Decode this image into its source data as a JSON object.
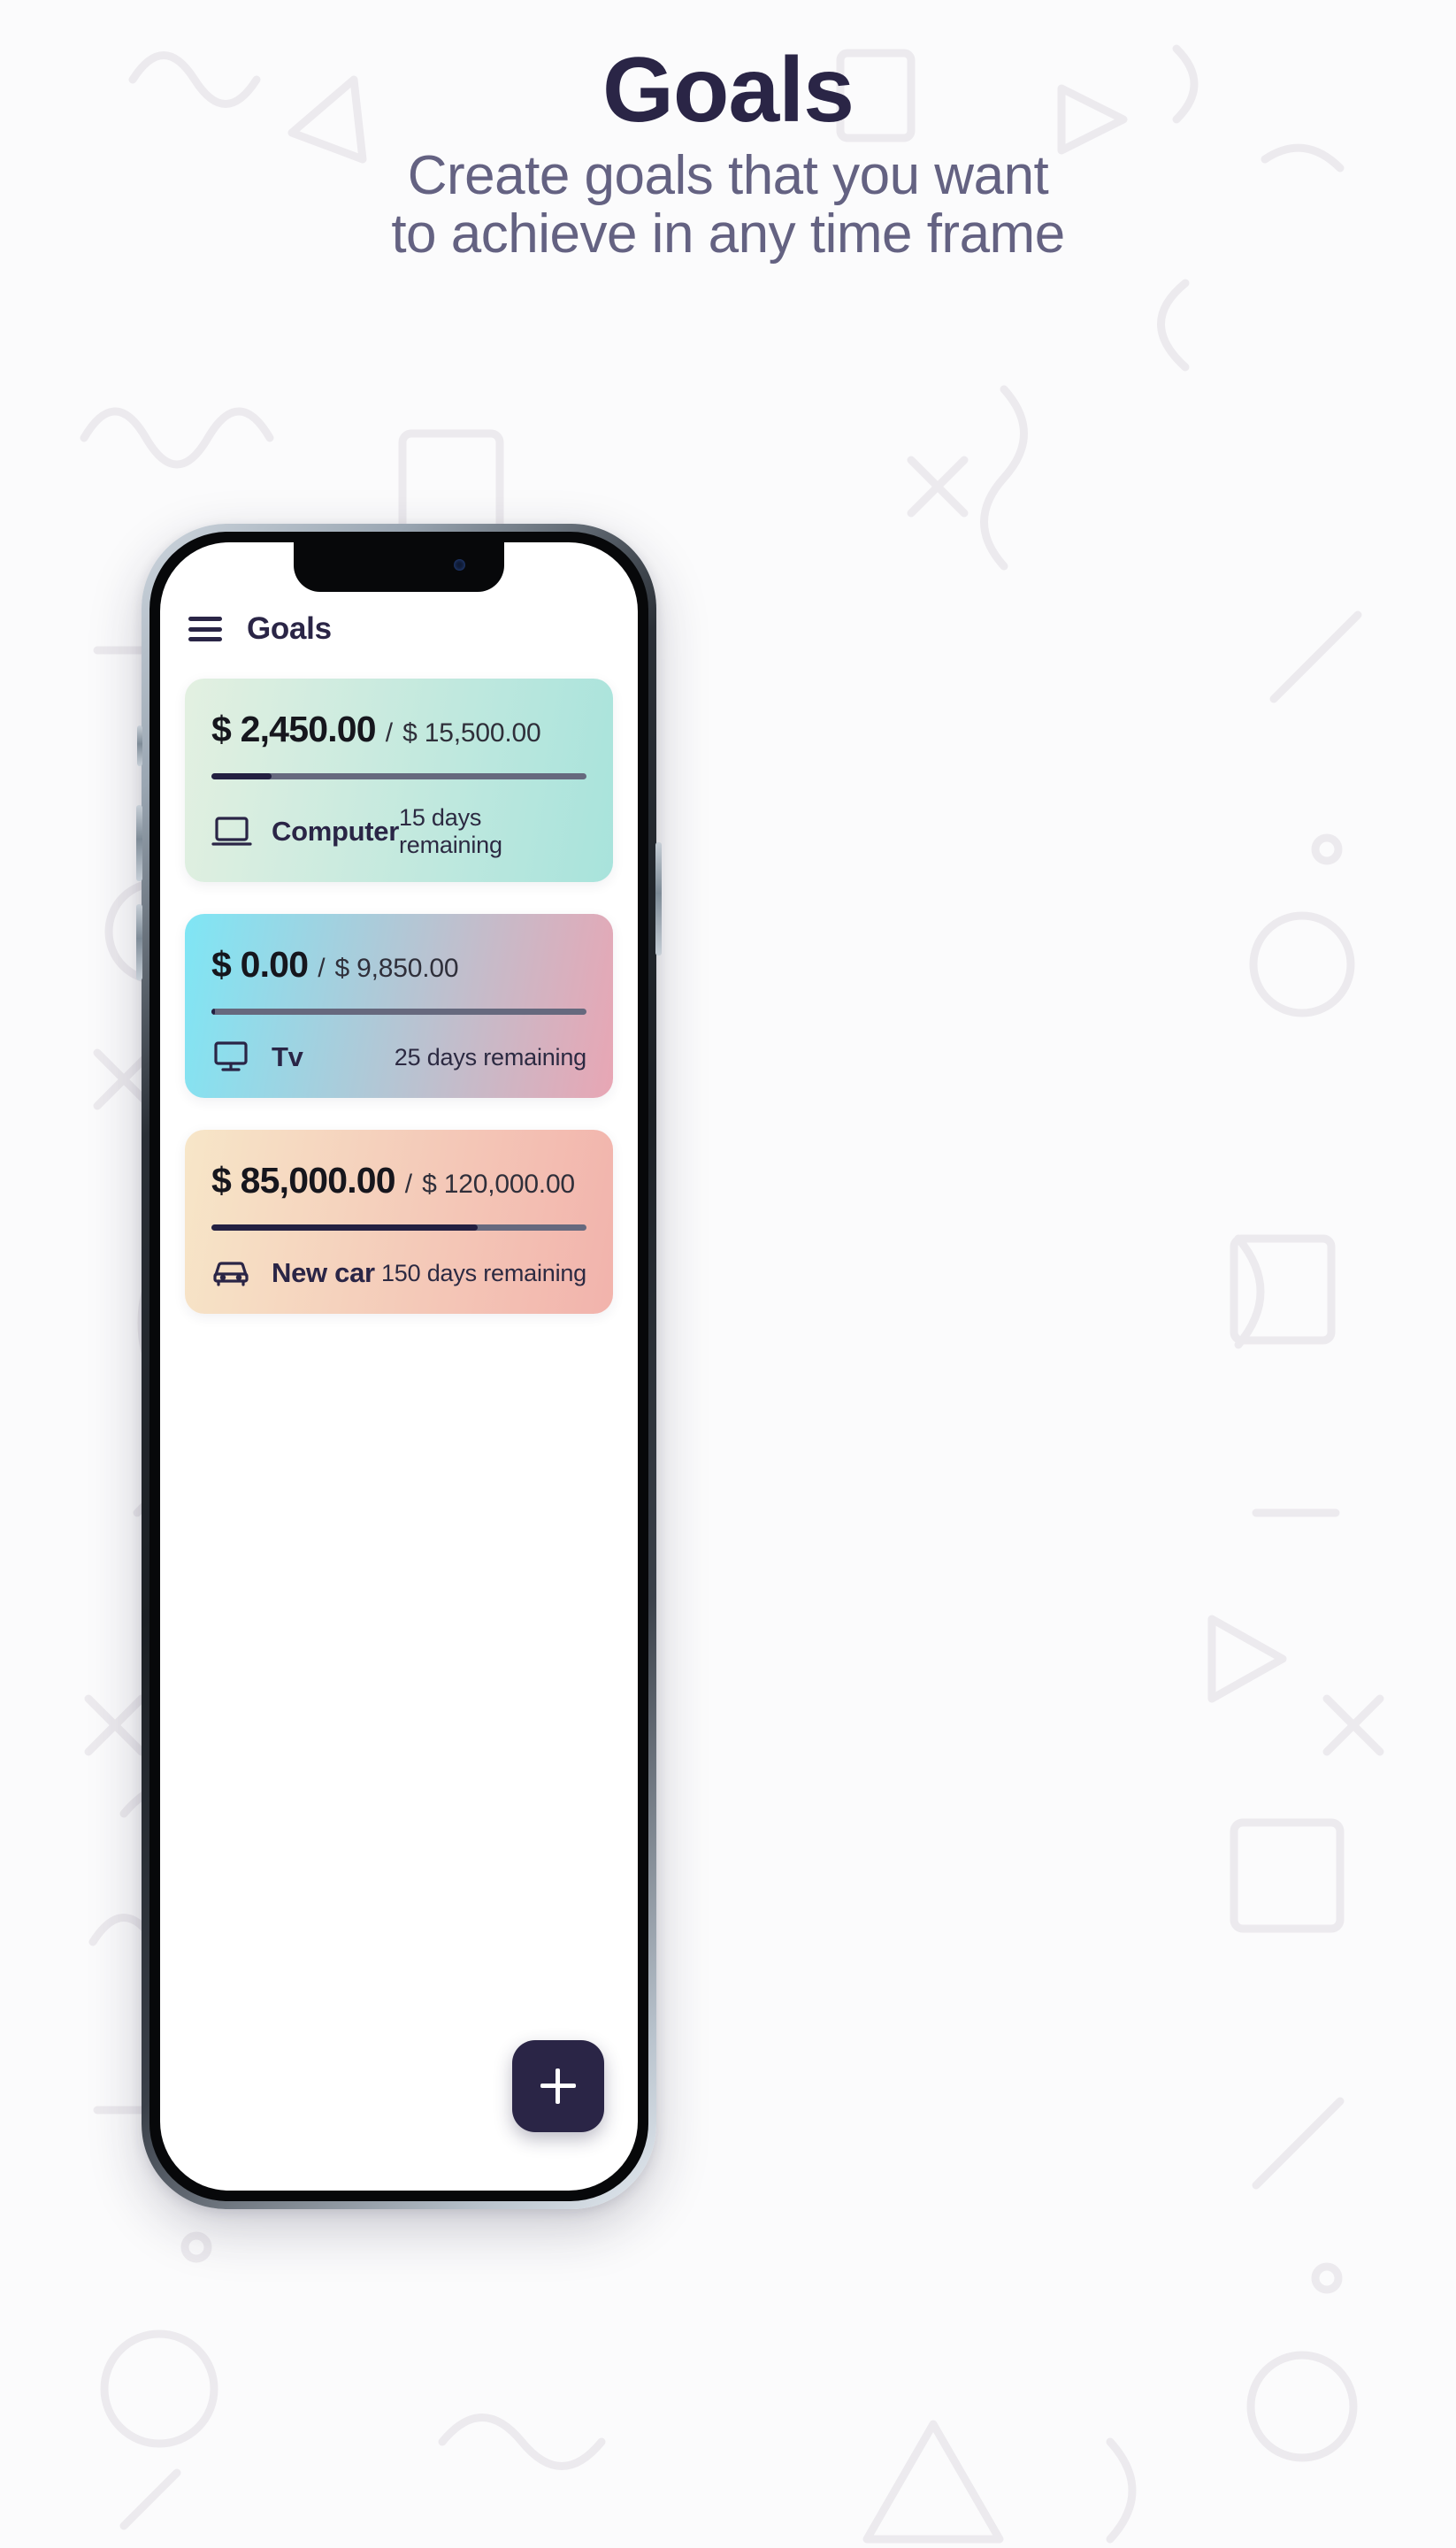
{
  "header": {
    "title": "Goals",
    "subtitle_line1": "Create goals that you want",
    "subtitle_line2": "to achieve in any time frame"
  },
  "phone": {
    "app_bar": {
      "menu_icon": "hamburger-menu-icon",
      "title": "Goals"
    },
    "goals": [
      {
        "current_amount": "$ 2,450.00",
        "separator": "/",
        "target_amount": "$ 15,500.00",
        "label": "Computer",
        "icon": "laptop-icon",
        "days_remaining": "15 days remaining",
        "progress_percent": 16,
        "gradient_from": "#e3f0e1",
        "gradient_to": "#a8e3dc"
      },
      {
        "current_amount": "$ 0.00",
        "separator": "/",
        "target_amount": "$ 9,850.00",
        "label": "Tv",
        "icon": "monitor-icon",
        "days_remaining": "25 days remaining",
        "progress_percent": 1,
        "gradient_from": "#7fe6f5",
        "gradient_to": "#e8a6b4"
      },
      {
        "current_amount": "$ 85,000.00",
        "separator": "/",
        "target_amount": "$ 120,000.00",
        "label": "New car",
        "icon": "car-icon",
        "days_remaining": "150 days remaining",
        "progress_percent": 71,
        "gradient_from": "#f7e6c8",
        "gradient_to": "#f2b3ac"
      }
    ],
    "fab": {
      "icon": "plus-icon",
      "label": "+"
    }
  },
  "colors": {
    "title": "#2a2546",
    "subtitle": "#646282",
    "accent_dark": "#232041",
    "page_background": "#fbfbfc",
    "progress_track": "#66697e"
  }
}
